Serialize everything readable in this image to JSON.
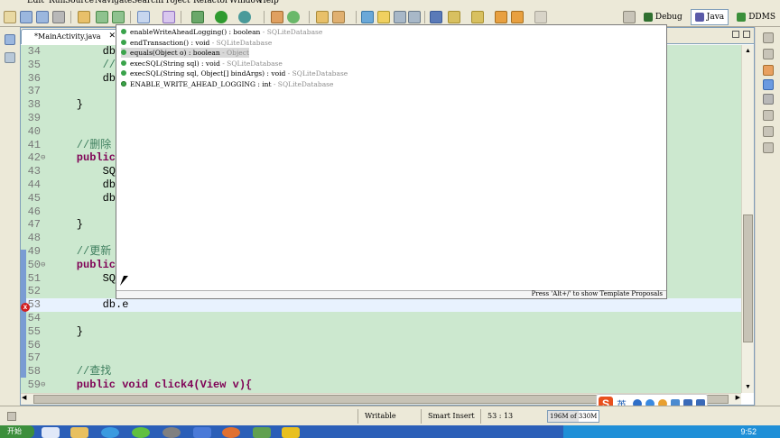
{
  "menu": [
    "Edit",
    "Run",
    "Source",
    "Navigate",
    "Search",
    "Project",
    "Refactor",
    "Window",
    "Help"
  ],
  "perspectives": [
    {
      "label": "Debug",
      "color": "#2f6f2f",
      "active": false
    },
    {
      "label": "Java",
      "color": "#5a5aa8",
      "active": true
    },
    {
      "label": "DDMS",
      "color": "#3a8f3a",
      "active": false
    }
  ],
  "editor": {
    "tab_label": "*MainActivity.java",
    "tab_close": "✕",
    "lines": [
      {
        "n": "34",
        "text": "        db.",
        "kind": "code"
      },
      {
        "n": "35",
        "text": "        //[",
        "kind": "comment"
      },
      {
        "n": "36",
        "text": "        db.",
        "kind": "code"
      },
      {
        "n": "37",
        "text": "",
        "kind": "code"
      },
      {
        "n": "38",
        "text": "    }",
        "kind": "code"
      },
      {
        "n": "39",
        "text": "",
        "kind": "code"
      },
      {
        "n": "40",
        "text": "",
        "kind": "code"
      },
      {
        "n": "41",
        "text": "    //删除",
        "kind": "comment"
      },
      {
        "n": "42",
        "text": "    public",
        "kind": "keyword",
        "fold": "⊖"
      },
      {
        "n": "43",
        "text": "        SQL",
        "kind": "code"
      },
      {
        "n": "44",
        "text": "        db.",
        "kind": "code"
      },
      {
        "n": "45",
        "text": "        db.",
        "kind": "code"
      },
      {
        "n": "46",
        "text": "",
        "kind": "code"
      },
      {
        "n": "47",
        "text": "    }",
        "kind": "code"
      },
      {
        "n": "48",
        "text": "",
        "kind": "code"
      },
      {
        "n": "49",
        "text": "    //更新",
        "kind": "comment"
      },
      {
        "n": "50",
        "text": "    public",
        "kind": "keyword",
        "fold": "⊖"
      },
      {
        "n": "51",
        "text": "        SQL",
        "kind": "code"
      },
      {
        "n": "52",
        "text": "",
        "kind": "code"
      },
      {
        "n": "53",
        "text": "        db.e",
        "kind": "code",
        "current": true
      },
      {
        "n": "54",
        "text": "",
        "kind": "code"
      },
      {
        "n": "55",
        "text": "    }",
        "kind": "code"
      },
      {
        "n": "56",
        "text": "",
        "kind": "code"
      },
      {
        "n": "57",
        "text": "",
        "kind": "code"
      },
      {
        "n": "58",
        "text": "    //查找",
        "kind": "comment"
      },
      {
        "n": "59",
        "text": "    public void click4(View v){",
        "kind": "keyword",
        "fold": "⊖"
      }
    ]
  },
  "assist": {
    "items": [
      {
        "sig": "enableWriteAheadLogging() : boolean",
        "owner": " - SQLiteDatabase",
        "selected": false,
        "static": false
      },
      {
        "sig": "endTransaction() : void",
        "owner": " - SQLiteDatabase",
        "selected": false,
        "static": false
      },
      {
        "sig": "equals(Object o) : boolean",
        "owner": " - Object",
        "selected": true,
        "static": false
      },
      {
        "sig": "execSQL(String sql) : void",
        "owner": " - SQLiteDatabase",
        "selected": false,
        "static": false
      },
      {
        "sig": "execSQL(String sql, Object[] bindArgs) : void",
        "owner": " - SQLiteDatabase",
        "selected": false,
        "static": false
      },
      {
        "sig": "ENABLE_WRITE_AHEAD_LOGGING : int",
        "owner": " - SQLiteDatabase",
        "selected": false,
        "static": true
      }
    ],
    "footer": "Press 'Alt+/' to show Template Proposals"
  },
  "status": {
    "writable": "Writable",
    "insert_mode": "Smart Insert",
    "position": "53 : 13",
    "heap": "196M of 330M"
  },
  "ime": {
    "logo": "S",
    "lang": "英"
  },
  "taskbar": {
    "start": "开始",
    "clock": "9:52"
  }
}
